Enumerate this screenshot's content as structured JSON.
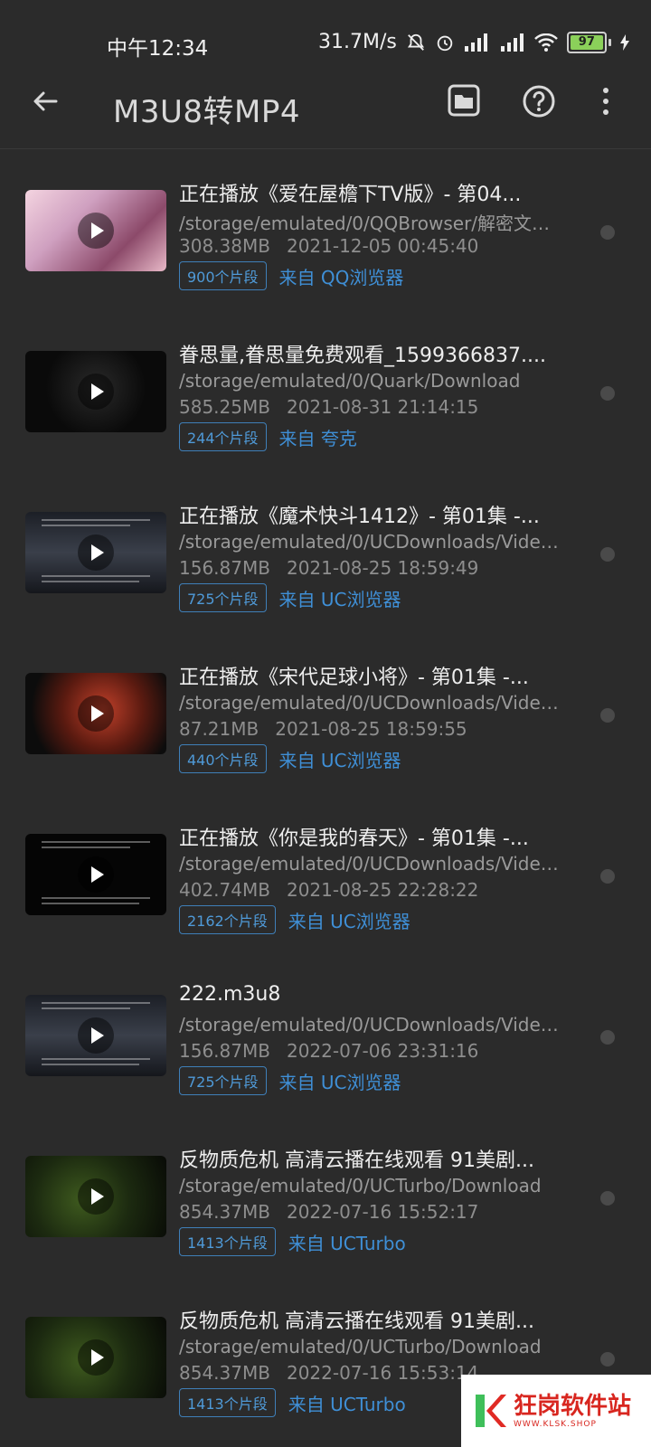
{
  "status_bar": {
    "time": "中午12:34",
    "speed": "31.7M/s",
    "battery": "97"
  },
  "app_bar": {
    "title": "M3U8转MP4",
    "icons": [
      "back-arrow-icon",
      "folder-icon",
      "help-icon",
      "more-vert-icon"
    ]
  },
  "items": [
    {
      "name": "正在播放《爱在屋檐下TV版》- 第04...",
      "path": "/storage/emulated/0/QQBrowser/解密文件/...",
      "size": "308.38MB",
      "date": "2021-12-05 00:45:40",
      "segments": "900个片段",
      "source": "来自  QQ浏览器",
      "thumb": "pink"
    },
    {
      "name": "眷思量,眷思量免费观看_1599366837....",
      "path": "/storage/emulated/0/Quark/Download",
      "size": "585.25MB",
      "date": "2021-08-31 21:14:15",
      "segments": "244个片段",
      "source": "来自  夸克",
      "thumb": "dark"
    },
    {
      "name": "正在播放《魔术快斗1412》- 第01集 -...",
      "path": "/storage/emulated/0/UCDownloads/Video...",
      "size": "156.87MB",
      "date": "2021-08-25 18:59:49",
      "segments": "725个片段",
      "source": "来自  UC浏览器",
      "thumb": "subs"
    },
    {
      "name": "正在播放《宋代足球小将》- 第01集 -...",
      "path": "/storage/emulated/0/UCDownloads/Video...",
      "size": "87.21MB",
      "date": "2021-08-25 18:59:55",
      "segments": "440个片段",
      "source": "来自  UC浏览器",
      "thumb": "red"
    },
    {
      "name": "正在播放《你是我的春天》- 第01集 -...",
      "path": "/storage/emulated/0/UCDownloads/Video...",
      "size": "402.74MB",
      "date": "2021-08-25 22:28:22",
      "segments": "2162个片段",
      "source": "来自  UC浏览器",
      "thumb": "black"
    },
    {
      "name": "222.m3u8",
      "path": "/storage/emulated/0/UCDownloads/Video...",
      "size": "156.87MB",
      "date": "2022-07-06 23:31:16",
      "segments": "725个片段",
      "source": "来自  UC浏览器",
      "thumb": "subs"
    },
    {
      "name": "反物质危机 高清云播在线观看  91美剧...",
      "path": "/storage/emulated/0/UCTurbo/Download",
      "size": "854.37MB",
      "date": "2022-07-16 15:52:17",
      "segments": "1413个片段",
      "source": "来自  UCTurbo",
      "thumb": "green"
    },
    {
      "name": "反物质危机 高清云播在线观看  91美剧...",
      "path": "/storage/emulated/0/UCTurbo/Download",
      "size": "854.37MB",
      "date": "2022-07-16 15:53:14",
      "segments": "1413个片段",
      "source": "来自  UCTurbo",
      "thumb": "green"
    }
  ],
  "watermark": {
    "main": "狂岗软件站",
    "sub": "WWW.KLSK.SHOP"
  }
}
